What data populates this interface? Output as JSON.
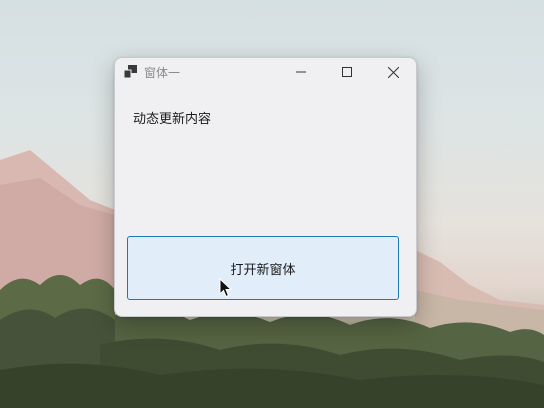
{
  "window": {
    "title": "窗体一",
    "dynamic_label": "动态更新内容",
    "open_button_label": "打开新窗体"
  },
  "icons": {
    "app": "app-window-icon",
    "minimize": "minimize-icon",
    "maximize": "maximize-icon",
    "close": "close-icon",
    "cursor": "mouse-pointer-icon"
  },
  "colors": {
    "window_bg": "#f0f0f3",
    "button_bg": "#e1eefa",
    "button_border": "#1b79b3",
    "text": "#1a1a1a",
    "title_text": "#8a8a8a"
  }
}
